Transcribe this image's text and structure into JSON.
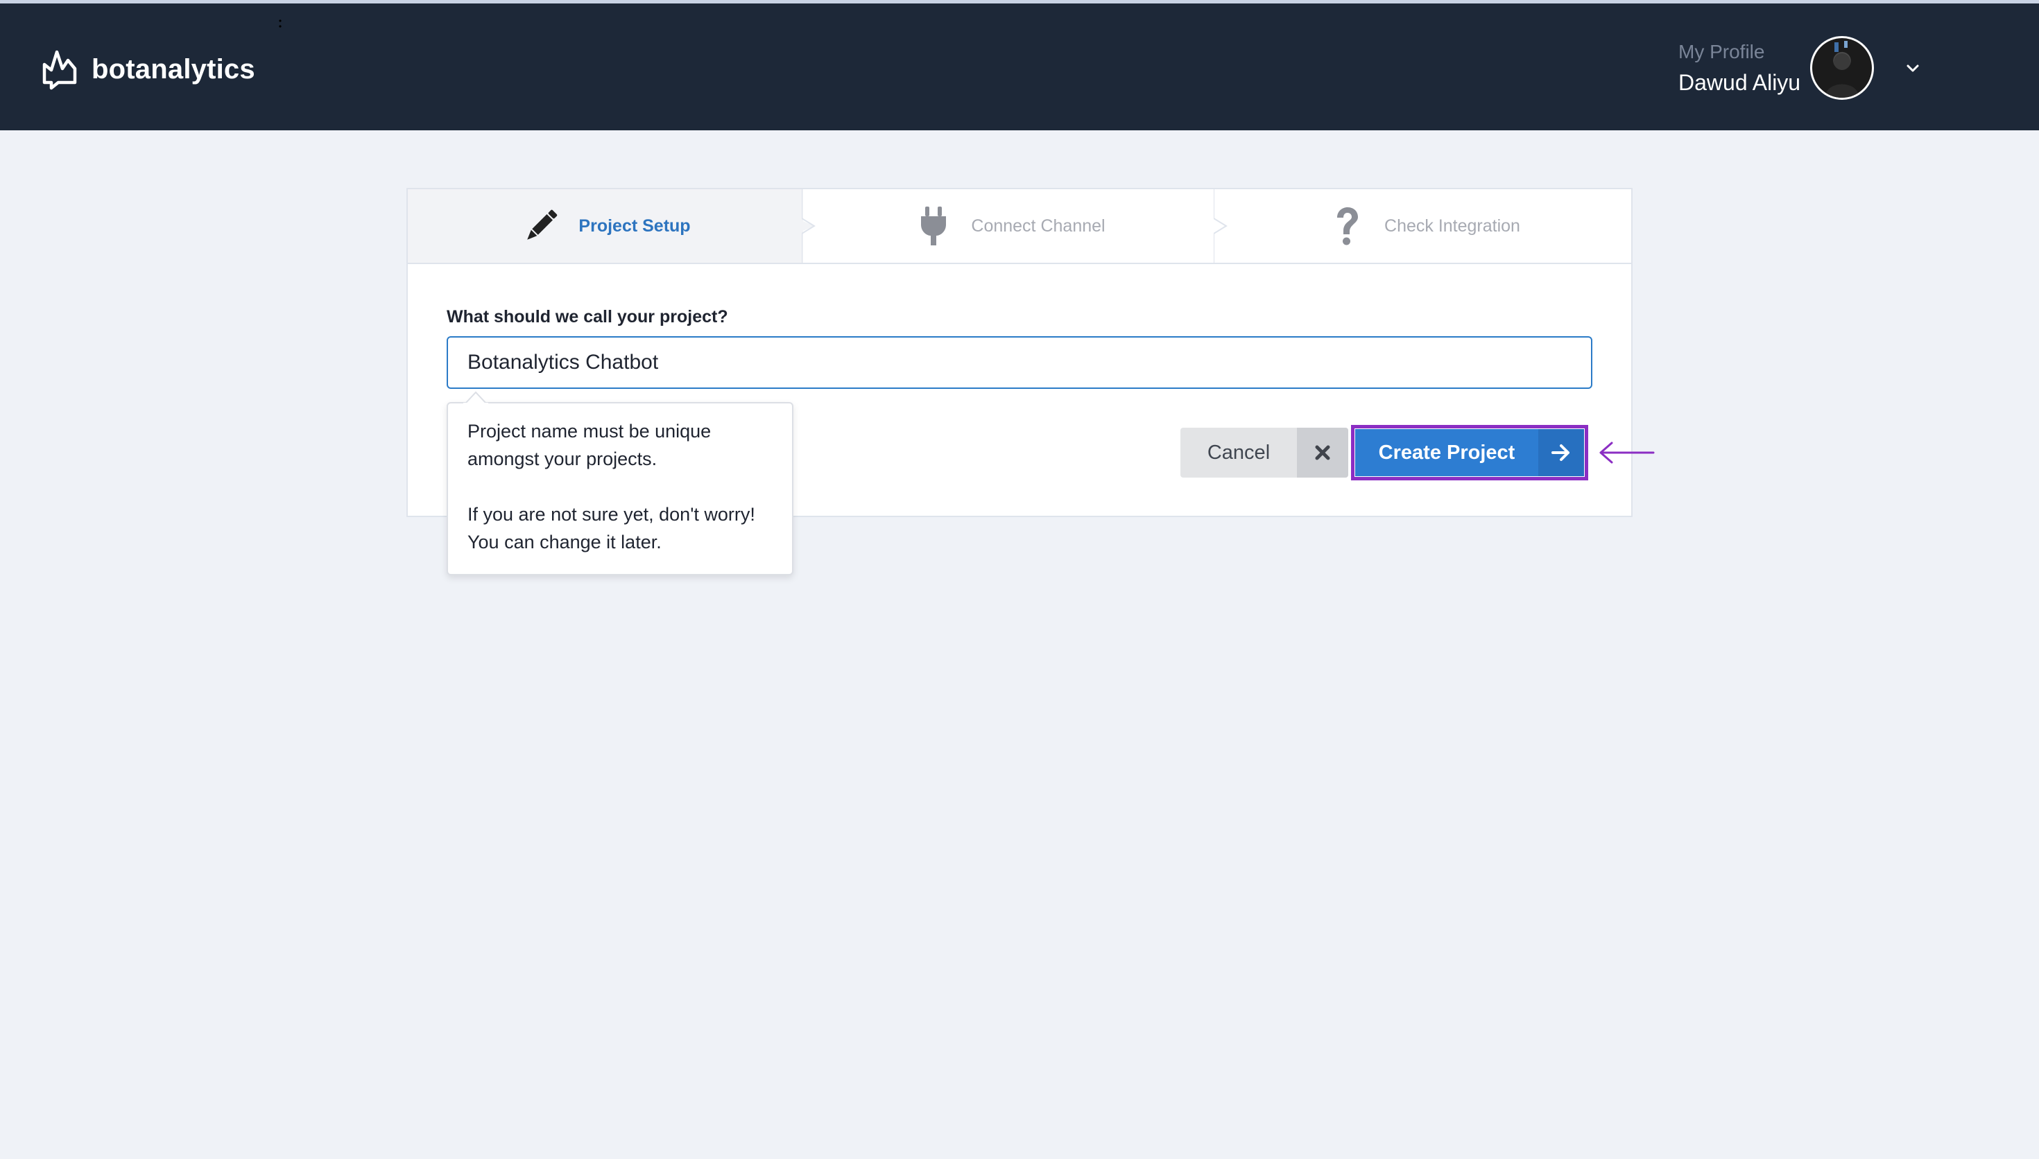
{
  "header": {
    "brand_name": "botanalytics",
    "profile_caption": "My Profile",
    "user_name": "Dawud Aliyu"
  },
  "wizard": {
    "steps": [
      {
        "label": "Project Setup",
        "icon": "pencil-icon",
        "state": "active"
      },
      {
        "label": "Connect Channel",
        "icon": "plug-icon",
        "state": "inactive"
      },
      {
        "label": "Check Integration",
        "icon": "question-icon",
        "state": "inactive"
      }
    ],
    "field_label": "What should we call your project?",
    "project_name_value": "Botanalytics Chatbot",
    "tooltip": {
      "line1": "Project name must be unique amongst your projects.",
      "line2": "If you are not sure yet, don't worry! You can change it later."
    },
    "cancel_label": "Cancel",
    "create_label": "Create Project"
  },
  "colors": {
    "header_bg": "#1d2838",
    "page_bg": "#eff2f7",
    "accent": "#2d7dd2",
    "active_step_text": "#2d74bf",
    "highlight_outline": "#8b2ec3"
  }
}
